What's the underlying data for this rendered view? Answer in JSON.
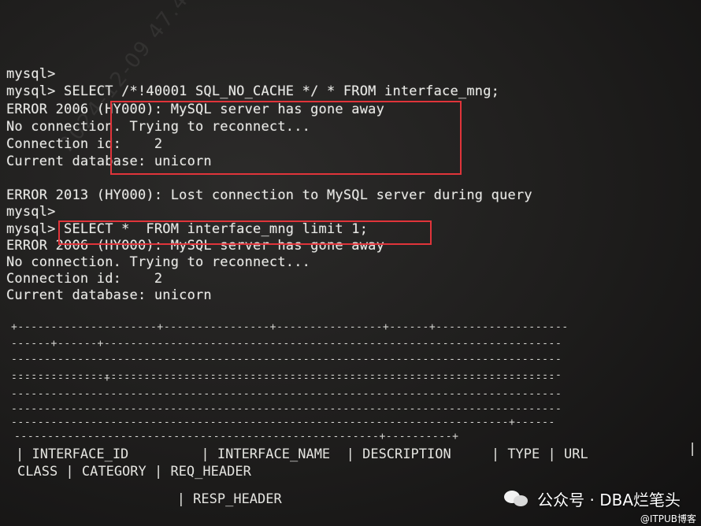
{
  "terminal": {
    "lines": [
      "mysql>",
      "mysql> SELECT /*!40001 SQL_NO_CACHE */ * FROM interface_mng;",
      "ERROR 2006 (HY000): MySQL server has gone away",
      "No connection. Trying to reconnect...",
      "Connection id:    2",
      "Current database: unicorn",
      "",
      "ERROR 2013 (HY000): Lost connection to MySQL server during query",
      "mysql>",
      "mysql> SELECT *  FROM interface_mng limit 1;",
      "ERROR 2006 (HY000): MySQL server has gone away",
      "No connection. Trying to reconnect...",
      "Connection id:    2",
      "Current database: unicorn"
    ],
    "border_lines": [
      "+---------------------+----------------+----------------+------+--------------------",
      "------+------+---------------------------------------------------------------------",
      "-----------------------------------------------------------------------------------",
      "-----------------------------------------------------------------------------------",
      "--------------+-------------------------------------------------------------------",
      "-----------------------------------------------------------------------------------",
      "-----------------------------------------------------------------------------------",
      "---------------------------------------------------------------------------+------",
      "-------------------------------------------------------+----------+"
    ],
    "header_lines": [
      "| INTERFACE_ID         | INTERFACE_NAME  | DESCRIPTION     | TYPE | URL",
      "CLASS | CATEGORY | REQ_HEADER",
      "",
      "                    | RESP_HEADER"
    ],
    "trailing_pipe": "|"
  },
  "watermark": {
    "source": "公众号 · DBA烂笔头",
    "credit": "@ITPUB博客",
    "faint_text": "2024-12-09 47.4"
  },
  "colors": {
    "background": "#1e1d1c",
    "text": "#e9e9e6",
    "highlight": "#e0343a"
  }
}
